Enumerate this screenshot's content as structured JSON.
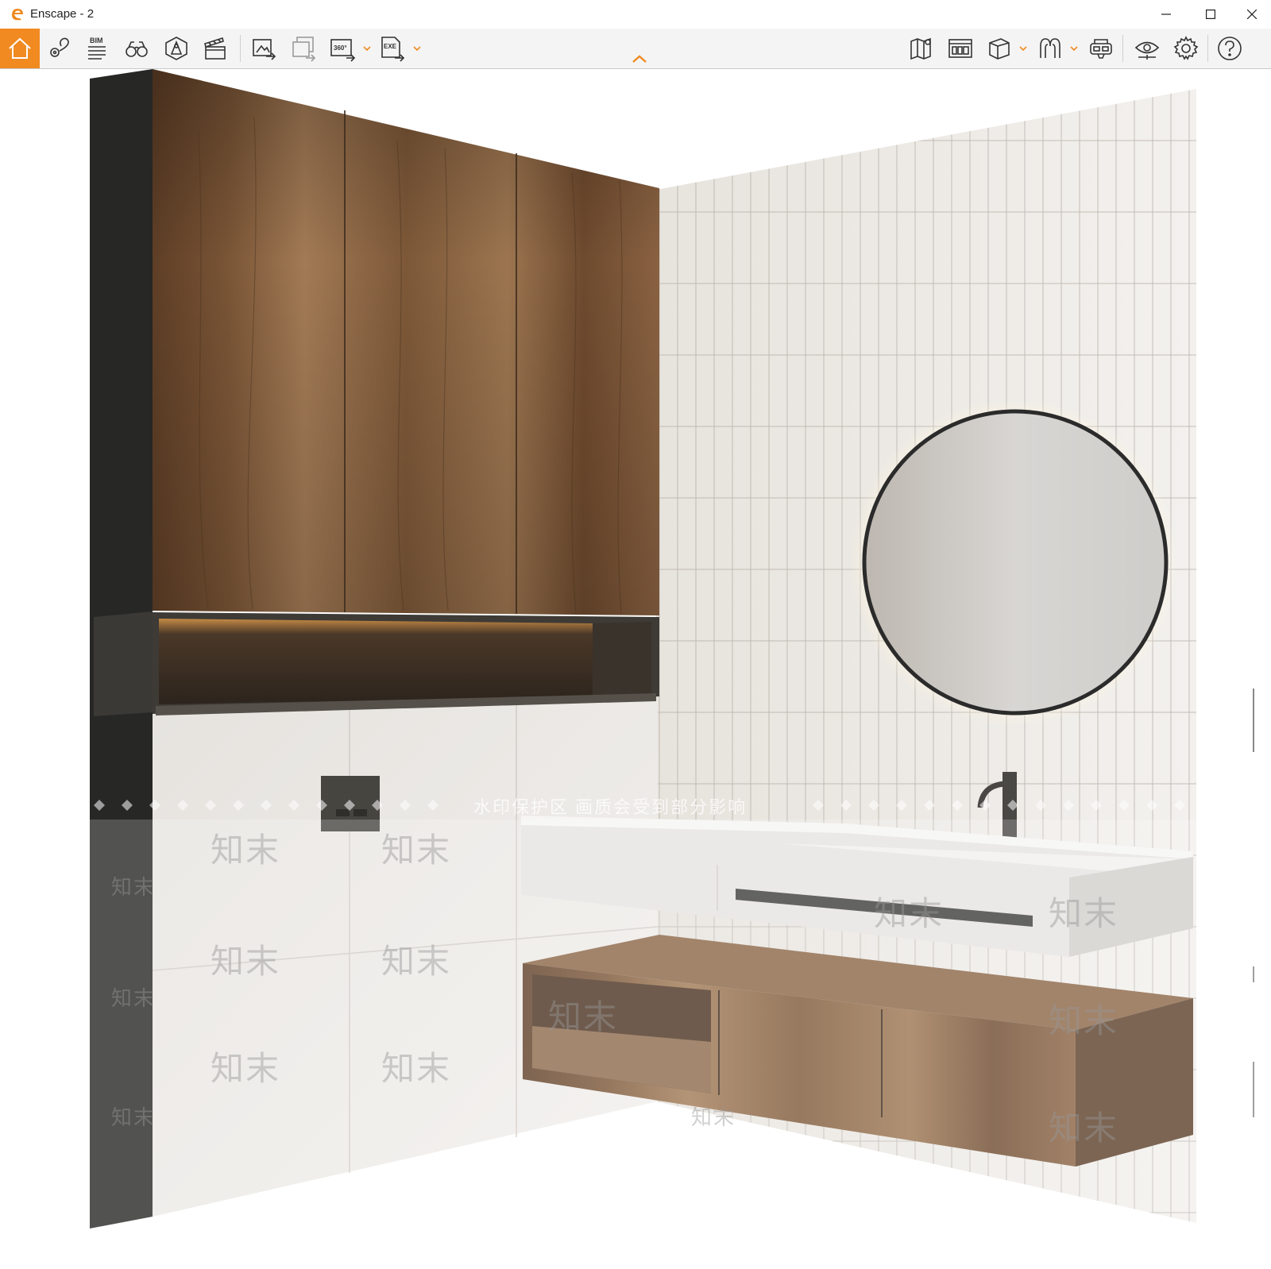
{
  "window": {
    "title": "Enscape - 2",
    "controls": {
      "minimize": "minimize-icon",
      "maximize": "maximize-icon",
      "close": "close-icon"
    }
  },
  "toolbar": {
    "active_tool": "home",
    "accent_color": "#f08a21",
    "left_tools": [
      {
        "icon": "home-icon"
      },
      {
        "icon": "location-pin-icon"
      },
      {
        "icon": "bim-info-icon",
        "label": "BIM"
      },
      {
        "icon": "binoculars-icon"
      },
      {
        "icon": "asset-library-icon"
      },
      {
        "icon": "video-clapper-icon"
      },
      {
        "icon": "screenshot-export-icon"
      },
      {
        "icon": "batch-render-icon"
      },
      {
        "icon": "panorama-360-icon",
        "label": "360°"
      },
      {
        "icon": "exe-export-icon",
        "label": "EXE"
      }
    ],
    "right_tools": [
      {
        "icon": "map-icon"
      },
      {
        "icon": "material-editor-icon"
      },
      {
        "icon": "cube-view-icon"
      },
      {
        "icon": "atmosphere-icon"
      },
      {
        "icon": "vr-headset-icon"
      },
      {
        "icon": "visual-settings-eye-icon"
      },
      {
        "icon": "settings-gear-icon"
      },
      {
        "icon": "help-icon"
      }
    ]
  },
  "viewport": {
    "watermark_text": "水印保护区   画质会受到部分影响",
    "watermark_brand": "知末"
  }
}
